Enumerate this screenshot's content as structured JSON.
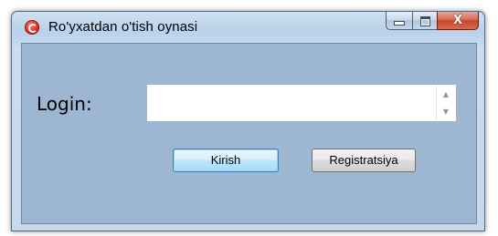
{
  "window": {
    "title": "Ro'yxatdan o'tish oynasi",
    "caption": {
      "minimize_icon": "minimize-icon",
      "maximize_icon": "maximize-icon",
      "close_glyph": "X"
    }
  },
  "form": {
    "login_label": "Login:",
    "login_value": "",
    "spin_up": "▲",
    "spin_down": "▼",
    "kirish_button": "Kirish",
    "registratsiya_button": "Registratsiya"
  },
  "colors": {
    "client_background": "#9db6d2",
    "close_button": "#c7462c",
    "default_button_border": "#3c7fb1"
  }
}
